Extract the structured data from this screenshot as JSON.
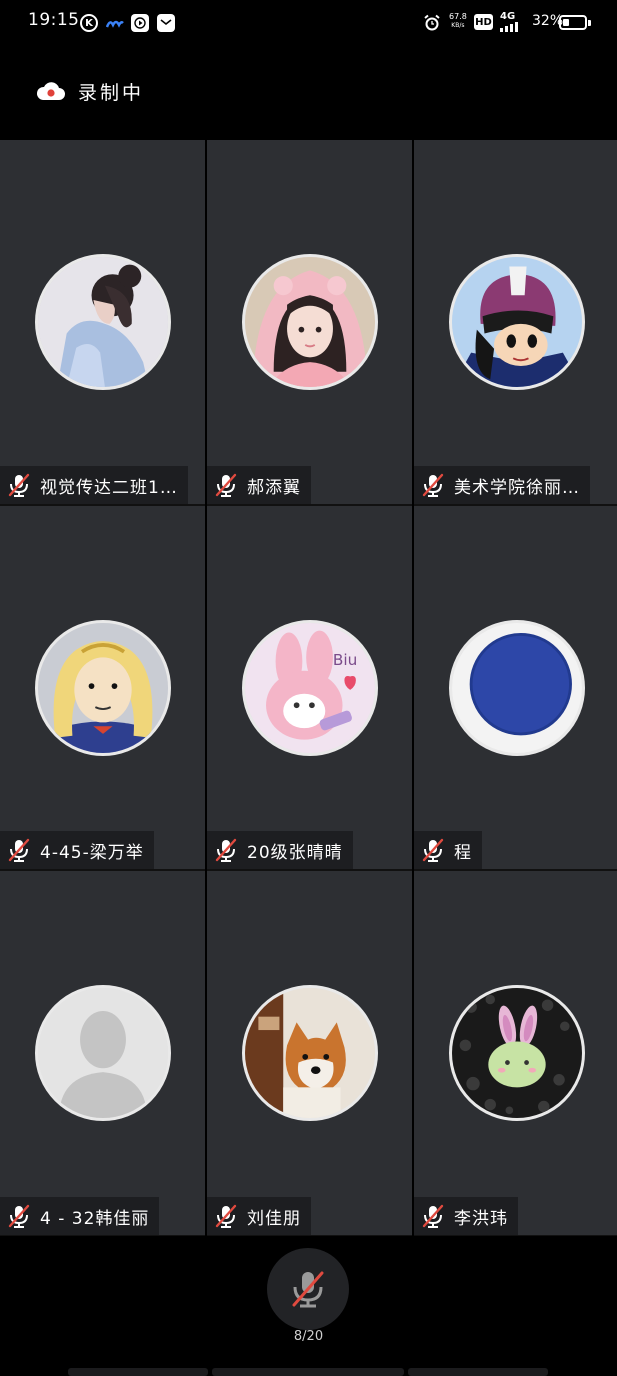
{
  "status_bar": {
    "time": "19:15",
    "app_icons": [
      "k-icon",
      "wave-icon",
      "play-icon",
      "mail-icon"
    ],
    "alarm_icon": "alarm-icon",
    "speed_value": "67.8",
    "speed_unit": "KB/s",
    "hd_label": "HD",
    "network_type": "4G",
    "battery_percent": "32%",
    "battery_level": 0.32
  },
  "recording": {
    "icon": "cloud-record-icon",
    "label": "录制中",
    "icon_color": "#e0413a"
  },
  "participants": [
    {
      "name": "视觉传达二班1…",
      "muted": true,
      "avatar": "portrait-photo-girl-hair-bun"
    },
    {
      "name": "郝添翼",
      "muted": true,
      "avatar": "portrait-photo-girl-pink-hood"
    },
    {
      "name": "美术学院徐丽…",
      "muted": true,
      "avatar": "cartoon-girl-helmet"
    },
    {
      "name": "4-45-梁万举",
      "muted": true,
      "avatar": "cartoon-bald-man-blonde-wig"
    },
    {
      "name": "20级张晴晴",
      "muted": true,
      "avatar": "cartoon-pink-bunny-biu"
    },
    {
      "name": "程",
      "muted": true,
      "avatar": "blue-circle-felt"
    },
    {
      "name": "4 - 32韩佳丽",
      "muted": true,
      "avatar": "default-person-silhouette"
    },
    {
      "name": "刘佳朋",
      "muted": true,
      "avatar": "shiba-dog-photo"
    },
    {
      "name": "李洪玮",
      "muted": true,
      "avatar": "green-bunny-mochi-photo"
    }
  ],
  "avatar_text": {
    "bunny_caption": "Biu"
  },
  "bottom": {
    "mic_icon": "mic-off-icon",
    "participant_count": "8/20"
  },
  "colors": {
    "background": "#000000",
    "tile": "#2d2f33",
    "name_tag": "#1d1e21",
    "mute_red": "#e04a3f"
  }
}
